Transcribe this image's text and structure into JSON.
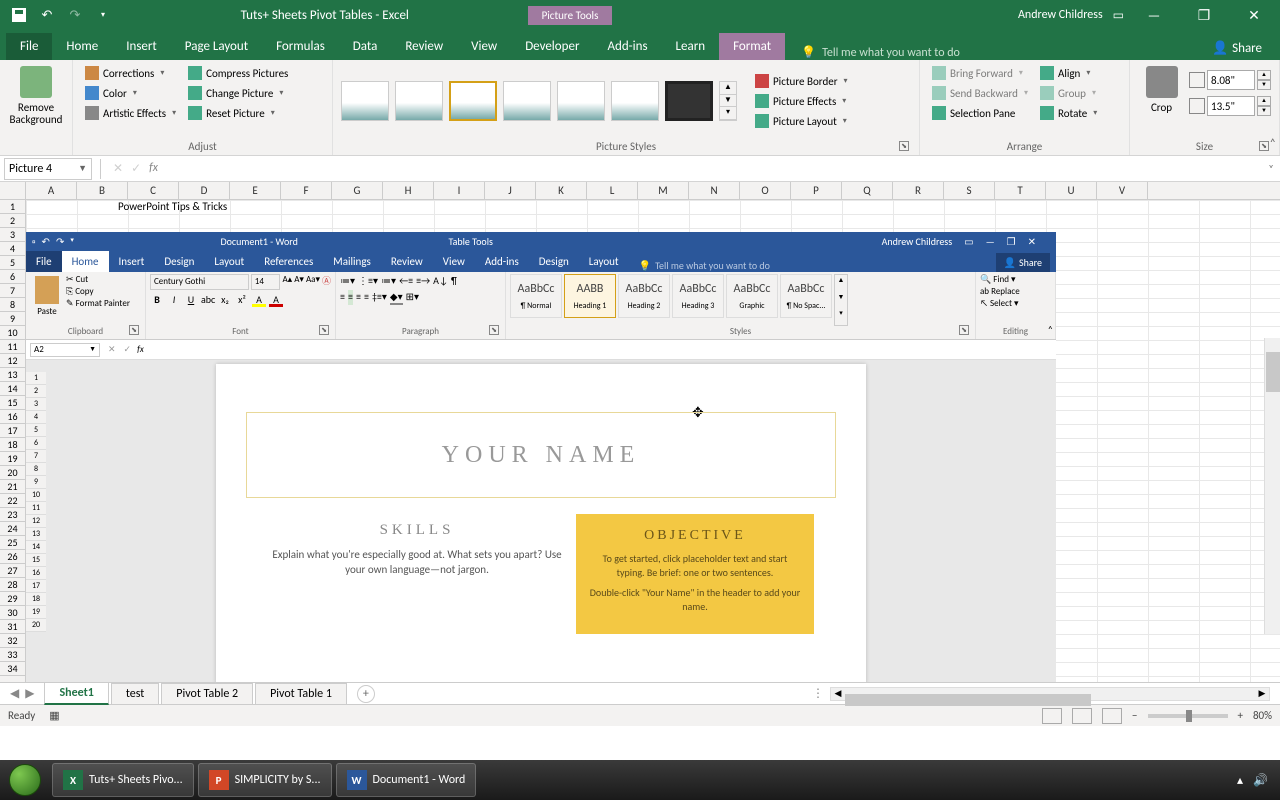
{
  "titlebar": {
    "app_title": "Tuts+ Sheets Pivot Tables  -  Excel",
    "context_tools": "Picture Tools",
    "user": "Andrew Childress"
  },
  "tabs": {
    "file": "File",
    "home": "Home",
    "insert": "Insert",
    "page_layout": "Page Layout",
    "formulas": "Formulas",
    "data": "Data",
    "review": "Review",
    "view": "View",
    "developer": "Developer",
    "addins": "Add-ins",
    "learn": "Learn",
    "format": "Format",
    "tell_me": "Tell me what you want to do",
    "share": "Share"
  },
  "ribbon": {
    "remove_bg": "Remove Background",
    "corrections": "Corrections",
    "color": "Color",
    "artistic": "Artistic Effects",
    "compress": "Compress Pictures",
    "change": "Change Picture",
    "reset": "Reset Picture",
    "group_adjust": "Adjust",
    "group_styles": "Picture Styles",
    "border": "Picture Border",
    "effects": "Picture Effects",
    "layout": "Picture Layout",
    "bring_fwd": "Bring Forward",
    "send_back": "Send Backward",
    "sel_pane": "Selection Pane",
    "align": "Align",
    "group": "Group",
    "rotate": "Rotate",
    "group_arrange": "Arrange",
    "crop": "Crop",
    "height": "8.08\"",
    "width": "13.5\"",
    "group_size": "Size"
  },
  "namebox": {
    "value": "Picture 4"
  },
  "columns": [
    "A",
    "B",
    "C",
    "D",
    "E",
    "F",
    "G",
    "H",
    "I",
    "J",
    "K",
    "L",
    "M",
    "N",
    "O",
    "P",
    "Q",
    "R",
    "S",
    "T",
    "U",
    "V"
  ],
  "cell_c1": "PowerPoint Tips & Tricks",
  "word": {
    "title": "Document1  -  Word",
    "tools": "Table Tools",
    "user": "Andrew Childress",
    "tabs": {
      "file": "File",
      "home": "Home",
      "insert": "Insert",
      "design": "Design",
      "layout": "Layout",
      "references": "References",
      "mailings": "Mailings",
      "review": "Review",
      "view": "View",
      "addins": "Add-ins",
      "tdesign": "Design",
      "tlayout": "Layout"
    },
    "tell_me": "Tell me what you want to do",
    "share": "Share",
    "clipboard": {
      "paste": "Paste",
      "cut": "Cut",
      "copy": "Copy",
      "painter": "Format Painter",
      "label": "Clipboard"
    },
    "font": {
      "name": "Century Gothi",
      "size": "14",
      "label": "Font"
    },
    "para_label": "Paragraph",
    "styles": {
      "label": "Styles",
      "items": [
        {
          "sample": "AaBbCc",
          "name": "¶ Normal"
        },
        {
          "sample": "AABB",
          "name": "Heading 1"
        },
        {
          "sample": "AaBbCc",
          "name": "Heading 2"
        },
        {
          "sample": "AaBbCc",
          "name": "Heading 3"
        },
        {
          "sample": "AaBbCc",
          "name": "Graphic"
        },
        {
          "sample": "AaBbCc",
          "name": "¶ No Spac..."
        }
      ]
    },
    "editing": {
      "find": "Find",
      "replace": "Replace",
      "select": "Select",
      "label": "Editing"
    },
    "namebox": "A2",
    "doc": {
      "name": "YOUR NAME",
      "skills_title": "SKILLS",
      "skills_text": "Explain what you're especially good at. What sets you apart? Use your own language—not jargon.",
      "obj_title": "OBJECTIVE",
      "obj_text1": "To get started, click placeholder text and start typing. Be brief: one or two sentences.",
      "obj_text2": "Double-click \"Your Name\" in the header to add your name."
    }
  },
  "sheets": {
    "s1": "Sheet1",
    "s2": "test",
    "s3": "Pivot Table 2",
    "s4": "Pivot Table 1"
  },
  "status": {
    "ready": "Ready",
    "zoom": "80%"
  },
  "taskbar": {
    "excel": "Tuts+ Sheets Pivo...",
    "ppt": "SIMPLICITY by S...",
    "word": "Document1 - Word"
  }
}
